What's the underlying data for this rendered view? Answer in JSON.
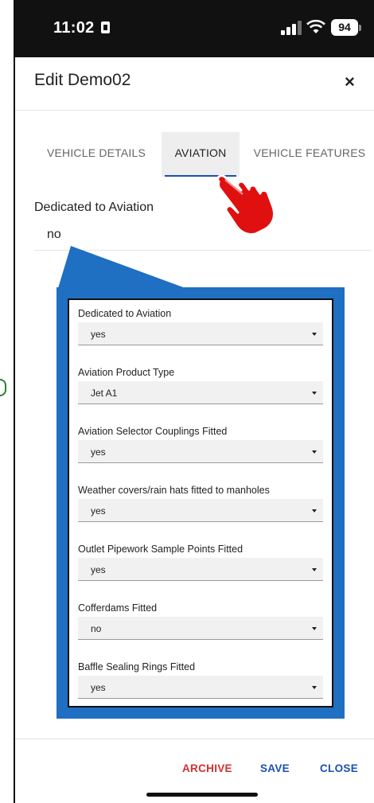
{
  "status_bar": {
    "time": "11:02",
    "battery": "94"
  },
  "header": {
    "title": "Edit Demo02",
    "close_label": "×"
  },
  "tabs": [
    {
      "label": "VEHICLE DETAILS"
    },
    {
      "label": "AVIATION"
    },
    {
      "label": "VEHICLE FEATURES"
    }
  ],
  "current_field": {
    "label": "Dedicated to Aviation",
    "value": "no"
  },
  "panel": {
    "items": [
      {
        "label": "Dedicated to Aviation",
        "value": "yes"
      },
      {
        "label": "Aviation Product Type",
        "value": "Jet A1"
      },
      {
        "label": "Aviation Selector Couplings Fitted",
        "value": "yes"
      },
      {
        "label": "Weather covers/rain hats fitted to manholes",
        "value": "yes"
      },
      {
        "label": "Outlet Pipework Sample Points Fitted",
        "value": "yes"
      },
      {
        "label": "Cofferdams Fitted",
        "value": "no"
      },
      {
        "label": "Baffle Sealing Rings Fitted",
        "value": "yes"
      }
    ]
  },
  "footer": {
    "archive": "ARCHIVE",
    "save": "SAVE",
    "close": "CLOSE"
  },
  "colors": {
    "accent_blue": "#1e4fb3",
    "callout_blue": "#1f6fc2",
    "archive_red": "#d32f2f",
    "pointer_red": "#e01010"
  },
  "icons": [
    "sim-icon",
    "signal-icon",
    "wifi-icon",
    "battery-icon",
    "close-icon",
    "pointing-hand-icon",
    "dropdown-arrow-icon"
  ]
}
